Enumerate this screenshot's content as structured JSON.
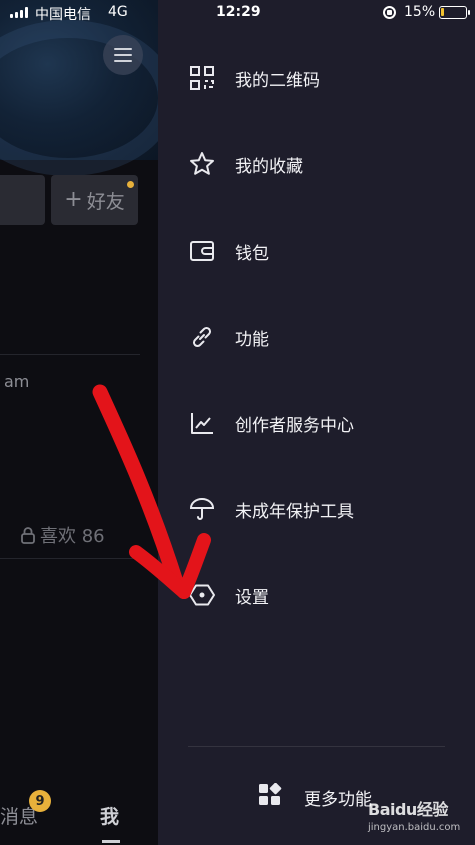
{
  "status_bar": {
    "carrier": "中国电信",
    "network": "4G",
    "time": "12:29",
    "battery_percent": "15%",
    "battery_level": 0.15
  },
  "profile": {
    "add_friend_label": "好友",
    "post_time_fragment": "am",
    "likes_label": "喜欢 86",
    "tabs": {
      "messages_label": "消息",
      "messages_badge": "9",
      "me_label": "我"
    }
  },
  "drawer": {
    "items": [
      {
        "label": "我的二维码",
        "icon": "qr-code-icon"
      },
      {
        "label": "我的收藏",
        "icon": "star-icon"
      },
      {
        "label": "钱包",
        "icon": "wallet-icon"
      },
      {
        "label": "功能",
        "icon": "link-icon"
      },
      {
        "label": "创作者服务中心",
        "icon": "chart-icon"
      },
      {
        "label": "未成年保护工具",
        "icon": "umbrella-icon"
      },
      {
        "label": "设置",
        "icon": "settings-hexagon-icon"
      }
    ],
    "more_label": "更多功能"
  },
  "colors": {
    "drawer_bg": "#1e1d2b",
    "accent_badge": "#e8b13b",
    "annotation_arrow": "#e3141a",
    "battery_fill": "#f2c230"
  },
  "watermark": {
    "logo_text": "Baidu经验",
    "url": "jingyan.baidu.com"
  }
}
